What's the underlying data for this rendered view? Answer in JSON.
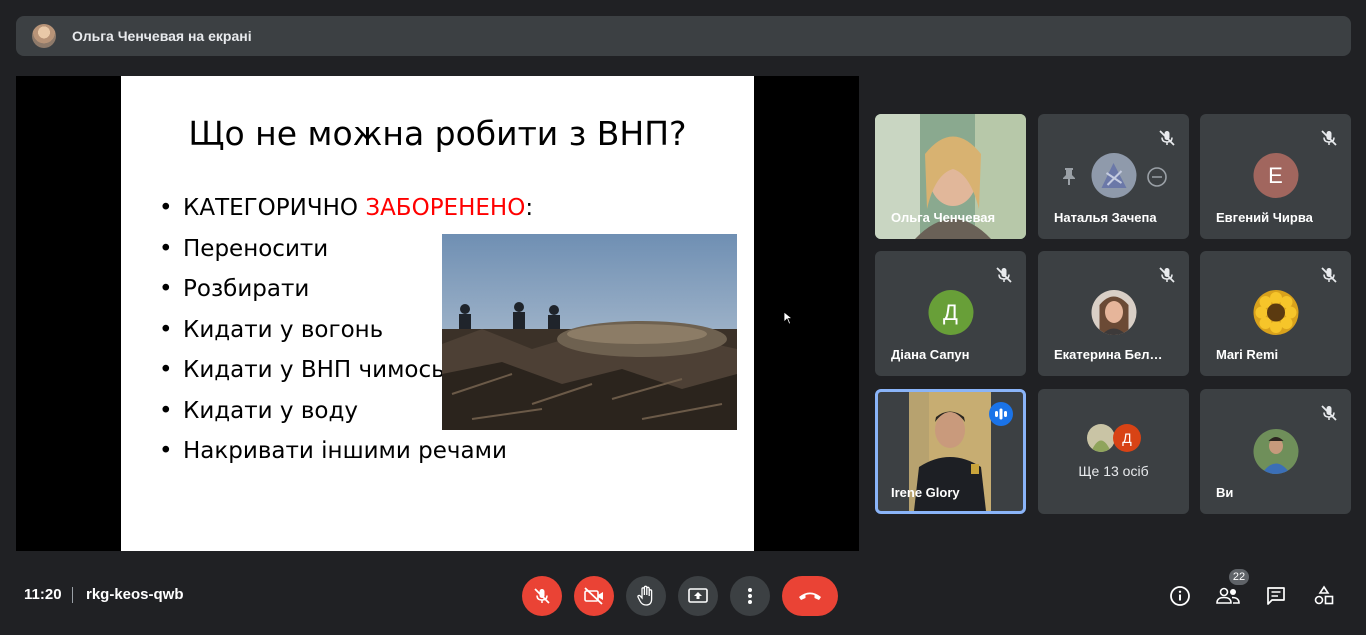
{
  "presenter": {
    "text": "Ольга Ченчевая на екрані"
  },
  "slide": {
    "title": "Що не можна робити з ВНП?",
    "first_item_prefix": "КАТЕГОРИЧНО ",
    "first_item_red": "ЗАБОРЕНЕНО",
    "first_item_suffix": ":",
    "items": [
      "Переносити",
      "Розбирати",
      "Кидати у вогонь",
      "Кидати у ВНП чимось",
      "Кидати у воду",
      "Накривати іншими речами"
    ]
  },
  "participants": [
    {
      "name": "Ольга Ченчевая",
      "type": "video"
    },
    {
      "name": "Наталья Зачепа",
      "type": "photo",
      "muted": true
    },
    {
      "name": "Евгений Чирва",
      "type": "letter",
      "letter": "Е",
      "color": "#a1665e",
      "muted": true
    },
    {
      "name": "Діана Сапун",
      "type": "letter",
      "letter": "Д",
      "color": "#689f38",
      "muted": true
    },
    {
      "name": "Екатерина Бел…",
      "type": "photo",
      "muted": true
    },
    {
      "name": "Mari Remi",
      "type": "photo",
      "muted": true
    },
    {
      "name": "Irene Glory",
      "type": "video",
      "speaking": true
    },
    {
      "name": "",
      "type": "more",
      "more_letter": "Д",
      "more_text": "Ще 13 осіб"
    },
    {
      "name": "Ви",
      "type": "photo",
      "muted": true
    }
  ],
  "bottom_bar": {
    "time": "11:20",
    "meeting_code": "rkg-keos-qwb",
    "people_count": "22"
  },
  "colors": {
    "accent_red": "#ea4335",
    "accent_blue": "#1a73e8",
    "tile_bg": "#3c4043"
  }
}
